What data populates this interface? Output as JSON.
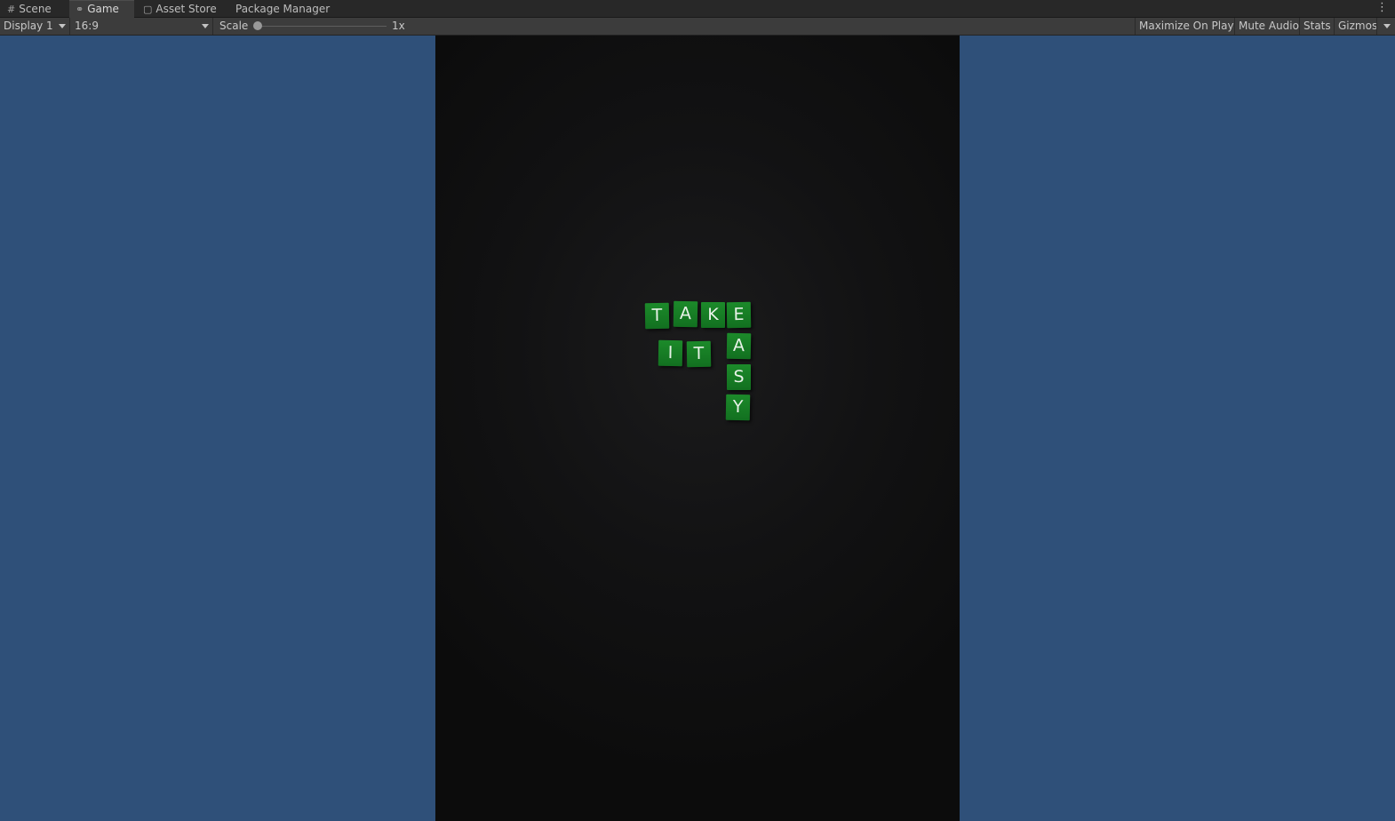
{
  "tabs": [
    {
      "label": "Scene",
      "icon": "grid-icon"
    },
    {
      "label": "Game",
      "icon": "gamepad-icon"
    },
    {
      "label": "Asset Store",
      "icon": "shopping-bag-icon"
    },
    {
      "label": "Package Manager",
      "icon": ""
    }
  ],
  "toolbar": {
    "display": "Display 1",
    "aspect": "16:9",
    "scale_label": "Scale",
    "scale_value": "1x",
    "scale_slider_level": 0.0,
    "maximize": "Maximize On Play",
    "mute": "Mute Audio",
    "stats": "Stats",
    "gizmos": "Gizmos"
  },
  "game": {
    "tiles": [
      "T",
      "A",
      "K",
      "E",
      "I",
      "T",
      "A",
      "S",
      "Y"
    ]
  },
  "colors": {
    "background": "#2f5079",
    "tile": "#15782a"
  }
}
